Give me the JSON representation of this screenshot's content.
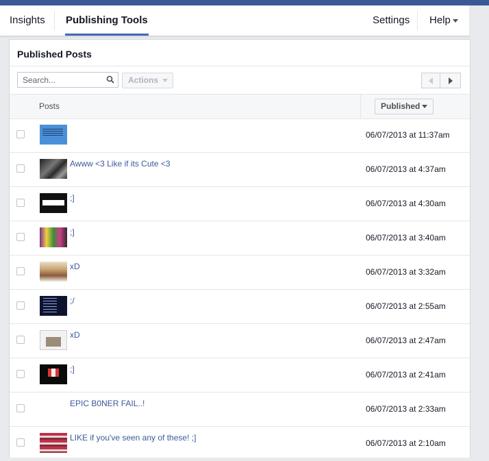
{
  "tabs": {
    "insights": "Insights",
    "publishing_tools": "Publishing Tools",
    "settings": "Settings",
    "help": "Help"
  },
  "panel": {
    "title": "Published Posts",
    "search_placeholder": "Search...",
    "actions_label": "Actions",
    "posts_column": "Posts",
    "sort_label": "Published"
  },
  "posts": [
    {
      "thumb": "t-blue",
      "text": "",
      "date": "06/07/2013 at 11:37am"
    },
    {
      "thumb": "t-dark",
      "text": "Awww <3 Like if its Cute <3",
      "date": "06/07/2013 at 4:37am"
    },
    {
      "thumb": "t-black-card",
      "text": ";]",
      "date": "06/07/2013 at 4:30am"
    },
    {
      "thumb": "t-colorful",
      "text": ";]",
      "date": "06/07/2013 at 3:40am"
    },
    {
      "thumb": "t-girl",
      "text": "xD",
      "date": "06/07/2013 at 3:32am"
    },
    {
      "thumb": "t-navy",
      "text": ";/",
      "date": "06/07/2013 at 2:55am"
    },
    {
      "thumb": "t-white-img",
      "text": "xD",
      "date": "06/07/2013 at 2:47am"
    },
    {
      "thumb": "t-stage",
      "text": ";]",
      "date": "06/07/2013 at 2:41am"
    },
    {
      "thumb": "t-none",
      "text": "EPIC B0NER FAIL..!",
      "date": "06/07/2013 at 2:33am"
    },
    {
      "thumb": "t-collage",
      "text": "LIKE if you've seen any of these! ;]",
      "date": "06/07/2013 at 2:10am"
    }
  ]
}
